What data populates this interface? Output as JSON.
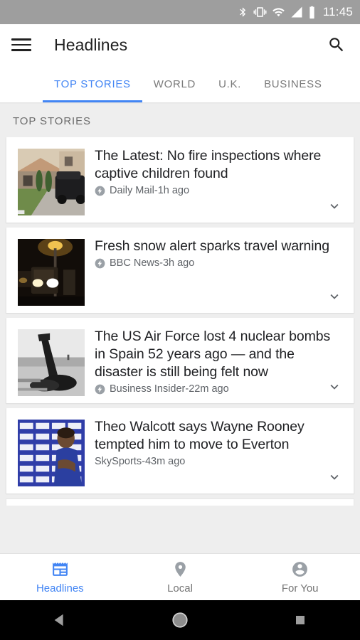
{
  "statusbar": {
    "time": "11:45",
    "icons": [
      "bluetooth-icon",
      "vibrate-icon",
      "wifi-icon",
      "signal-icon",
      "battery-icon"
    ]
  },
  "appbar": {
    "menu_icon": "hamburger-menu-icon",
    "title": "Headlines",
    "search_icon": "search-icon"
  },
  "tabs": [
    {
      "label": "TOP STORIES",
      "active": true
    },
    {
      "label": "WORLD",
      "active": false
    },
    {
      "label": "U.K.",
      "active": false
    },
    {
      "label": "BUSINESS",
      "active": false
    }
  ],
  "feed": {
    "section_label": "TOP STORIES",
    "articles": [
      {
        "headline": "The Latest: No fire inspections where captive children found",
        "source": "Daily Mail",
        "separator": " - ",
        "time": "1h ago",
        "amp": true,
        "thumbnail": "house-with-suv-thumbnail",
        "expand_icon": "chevron-down-icon"
      },
      {
        "headline": "Fresh snow alert sparks travel warning",
        "source": "BBC News",
        "separator": " - ",
        "time": "3h ago",
        "amp": true,
        "thumbnail": "night-road-traffic-thumbnail",
        "expand_icon": "chevron-down-icon"
      },
      {
        "headline": "The US Air Force lost 4 nuclear bombs in Spain 52 years ago — and the disaster is still being felt now",
        "source": "Business Insider",
        "separator": " - ",
        "time": "22m ago",
        "amp": true,
        "thumbnail": "crash-wreckage-bw-thumbnail",
        "expand_icon": "chevron-down-icon"
      },
      {
        "headline": "Theo Walcott says Wayne Rooney tempted him to move to Everton",
        "source": "SkySports",
        "separator": " - ",
        "time": "43m ago",
        "amp": false,
        "thumbnail": "footballer-press-conference-thumbnail",
        "expand_icon": "chevron-down-icon"
      }
    ]
  },
  "bottomnav": [
    {
      "label": "Headlines",
      "icon": "newspaper-icon",
      "active": true
    },
    {
      "label": "Local",
      "icon": "location-pin-icon",
      "active": false
    },
    {
      "label": "For You",
      "icon": "account-circle-icon",
      "active": false
    }
  ],
  "systembar": {
    "back_icon": "back-triangle-icon",
    "home_icon": "home-circle-icon",
    "recents_icon": "recents-square-icon"
  },
  "colors": {
    "accent": "#4285f4",
    "statusbar_bg": "#9e9e9e",
    "card_bg": "#ffffff",
    "feed_bg": "#eeeeee",
    "text_primary": "#202124",
    "text_secondary": "#5f6368"
  }
}
